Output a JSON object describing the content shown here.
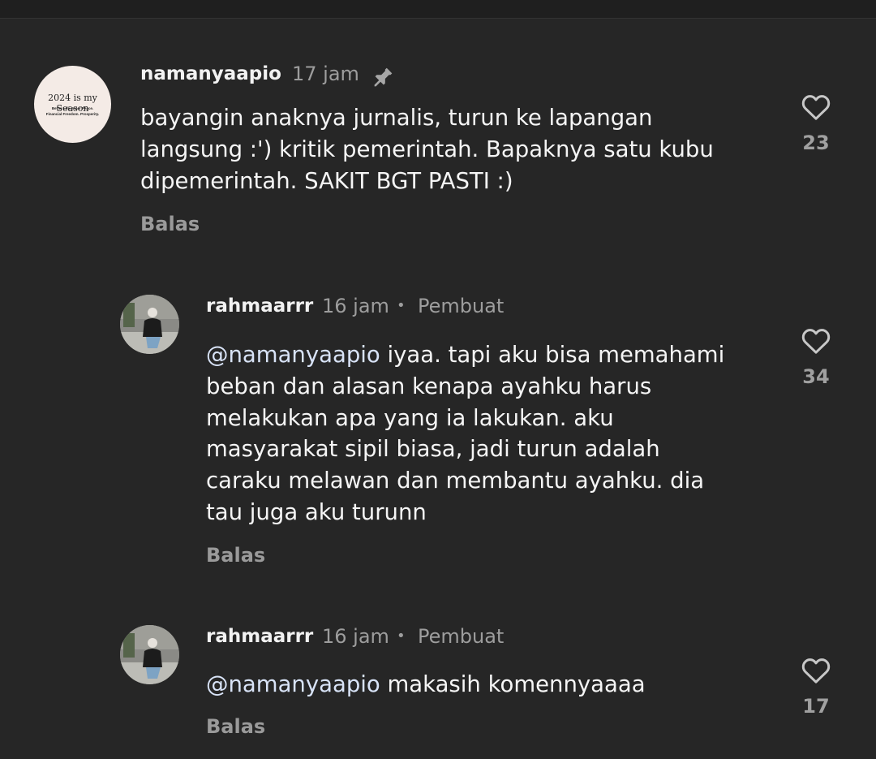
{
  "comments": [
    {
      "username": "namanyaapio",
      "time": "17 jam",
      "pinned_icon": "pin-icon",
      "text": "bayangin anaknya jurnalis, turun ke lapangan\nlangsung :') kritik pemerintah. Bapaknya satu kubu\ndipemerintah. SAKIT BGT PASTI :)",
      "reply_label": "Balas",
      "likes": "23",
      "avatar_text": {
        "line1": "2024 is my Season",
        "line2": "Better Life. Inner Peace.",
        "line3": "Financial Freedom. Prosperity."
      }
    },
    {
      "username": "rahmaarrr",
      "time": "16 jam",
      "separator": "•",
      "badge": "Pembuat",
      "mention": "@namanyaapio",
      "text": " iyaa. tapi aku bisa memahami\nbeban dan alasan kenapa ayahku harus\nmelakukan apa yang ia lakukan. aku\nmasyarakat sipil biasa, jadi turun adalah\ncaraku melawan dan membantu ayahku. dia\ntau juga aku turunn",
      "reply_label": "Balas",
      "likes": "34"
    },
    {
      "username": "rahmaarrr",
      "time": "16 jam",
      "separator": "•",
      "badge": "Pembuat",
      "mention": "@namanyaapio",
      "text": " makasih komennyaaaa",
      "reply_label": "Balas",
      "likes": "17"
    }
  ],
  "colors": {
    "background": "#262626",
    "text": "#f5f5f5",
    "muted": "#9d9d9d",
    "mention": "#d8e3f7"
  }
}
